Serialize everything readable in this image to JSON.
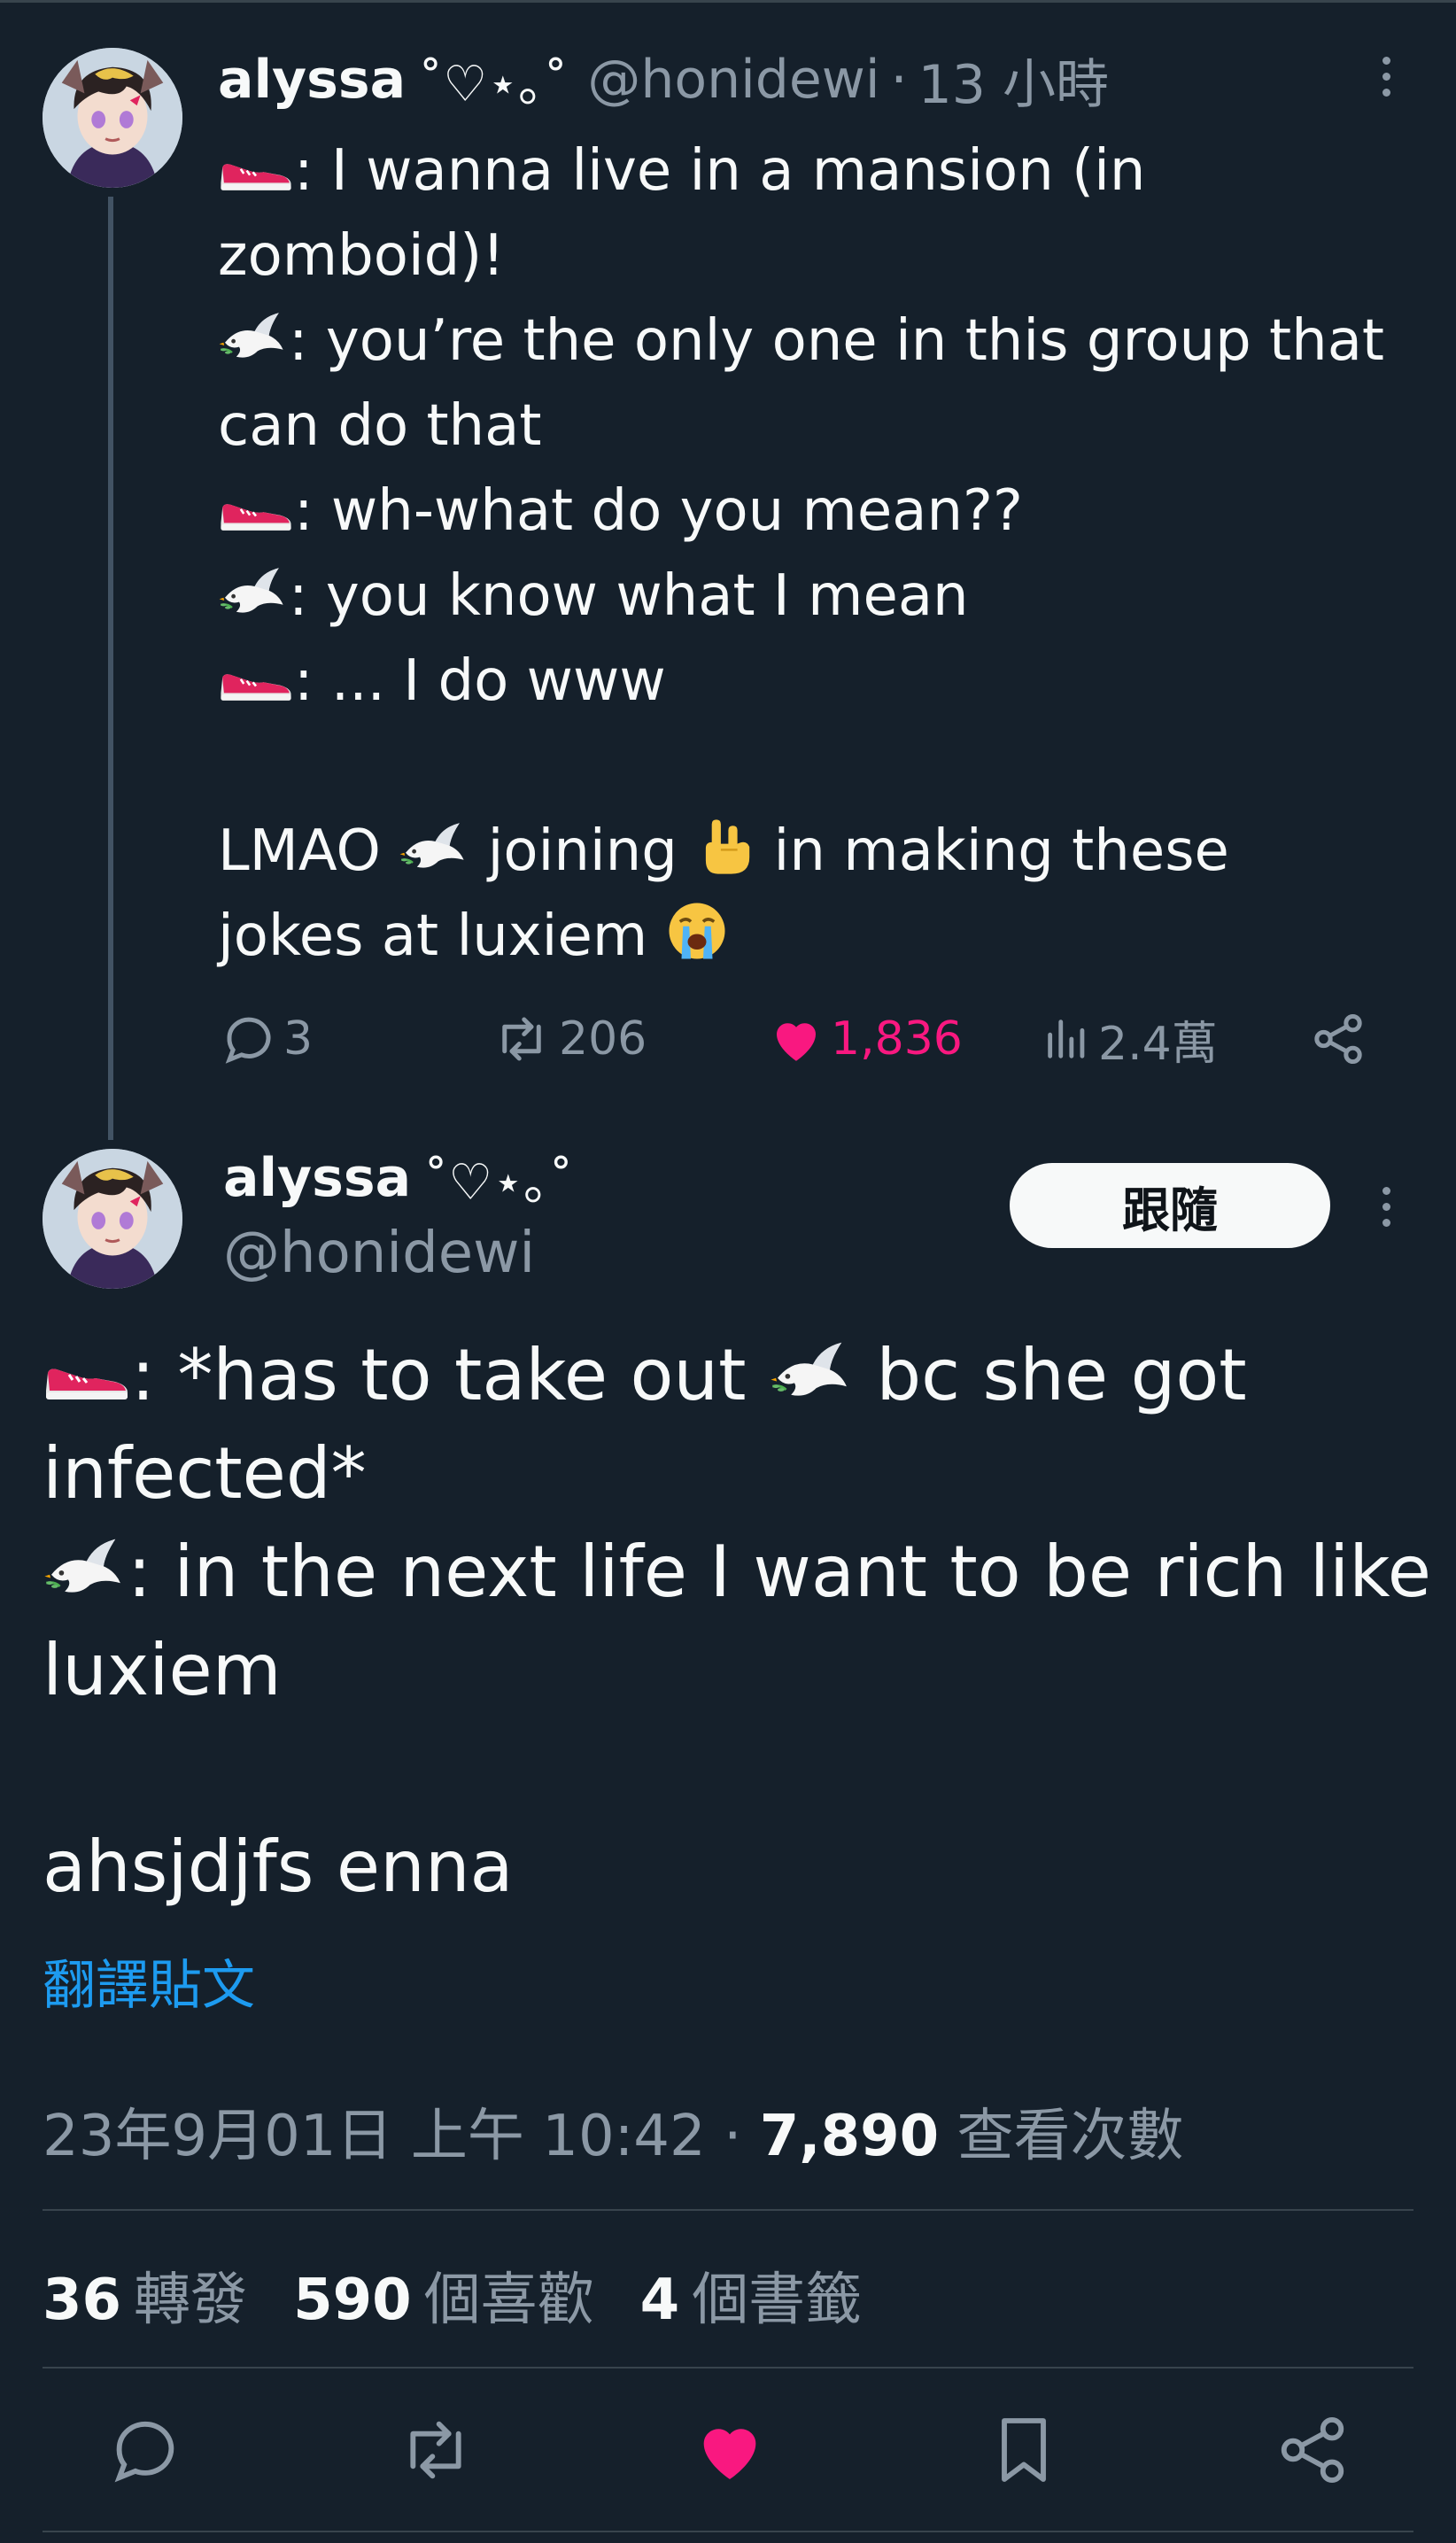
{
  "parent_tweet": {
    "author_name": "alyssa",
    "name_decoration": "˚♡⋆｡˚",
    "handle": "@honidewi",
    "separator": "·",
    "time": "13 小時",
    "lines": [
      {
        "emoji": "sneaker-icon",
        "text": ": I wanna live in a mansion (in"
      },
      {
        "emoji": "",
        "text": "zomboid)!"
      },
      {
        "emoji": "dove-icon",
        "text": ": you’re the only one in this group that"
      },
      {
        "emoji": "",
        "text": "can do that"
      },
      {
        "emoji": "sneaker-icon",
        "text": ": wh-what do you mean??"
      },
      {
        "emoji": "dove-icon",
        "text": ": you know what I mean"
      },
      {
        "emoji": "sneaker-icon",
        "text": ": ... I do www"
      }
    ],
    "closing": {
      "part1": "LMAO ",
      "part2": " joining ",
      "part3": " in making these",
      "part4": "jokes at luxiem "
    },
    "actions": {
      "replies": "3",
      "retweets": "206",
      "likes": "1,836",
      "views": "2.4萬"
    }
  },
  "main_tweet": {
    "author_name": "alyssa",
    "name_decoration": "˚♡⋆｡˚",
    "handle": "@honidewi",
    "follow_label": "跟隨",
    "lines": {
      "l1a": ": *has to take out ",
      "l1b": " bc she got",
      "l2": "infected*",
      "l3": ": in the next life I want to be rich like",
      "l4": "luxiem",
      "l5": "ahsjdjfs enna"
    },
    "translate_label": "翻譯貼文",
    "timestamp": "23年9月01日 上午 10:42",
    "separator": "·",
    "views_count": "7,890",
    "views_label": "查看次數",
    "stats": {
      "retweets_count": "36",
      "retweets_label": "轉發",
      "likes_count": "590",
      "likes_label": "個喜歡",
      "bookmarks_count": "4",
      "bookmarks_label": "個書籤"
    }
  },
  "colors": {
    "background": "#15202b",
    "text": "#f7f9f9",
    "secondary": "#8b98a5",
    "like": "#f91880",
    "link": "#1d9bf0",
    "divider": "#38444d"
  }
}
